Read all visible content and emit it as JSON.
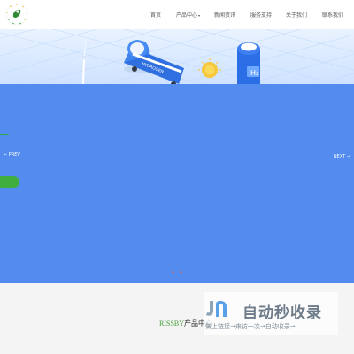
{
  "header": {
    "nav": [
      {
        "label": "首页",
        "has_dropdown": false
      },
      {
        "label": "产品中心",
        "has_dropdown": true
      },
      {
        "label": "新闻资讯",
        "has_dropdown": false
      },
      {
        "label": "服务支持",
        "has_dropdown": false
      },
      {
        "label": "关于我们",
        "has_dropdown": false
      },
      {
        "label": "联系我们",
        "has_dropdown": false
      }
    ],
    "dropdown_caret": "▾"
  },
  "hero": {
    "tank_label": "HYDROGEN",
    "cylinder_label": "H₂"
  },
  "banner": {
    "prev_label": "← PREV",
    "next_label": "NEXT →",
    "background": "#538cee",
    "accent_green": "#3fae3f"
  },
  "products": {
    "brand": "RISSBY",
    "title": "产品中心"
  },
  "watermark": {
    "title": "自动秒收录",
    "subtitle": "做上链接→来访一次→自动收录→"
  }
}
